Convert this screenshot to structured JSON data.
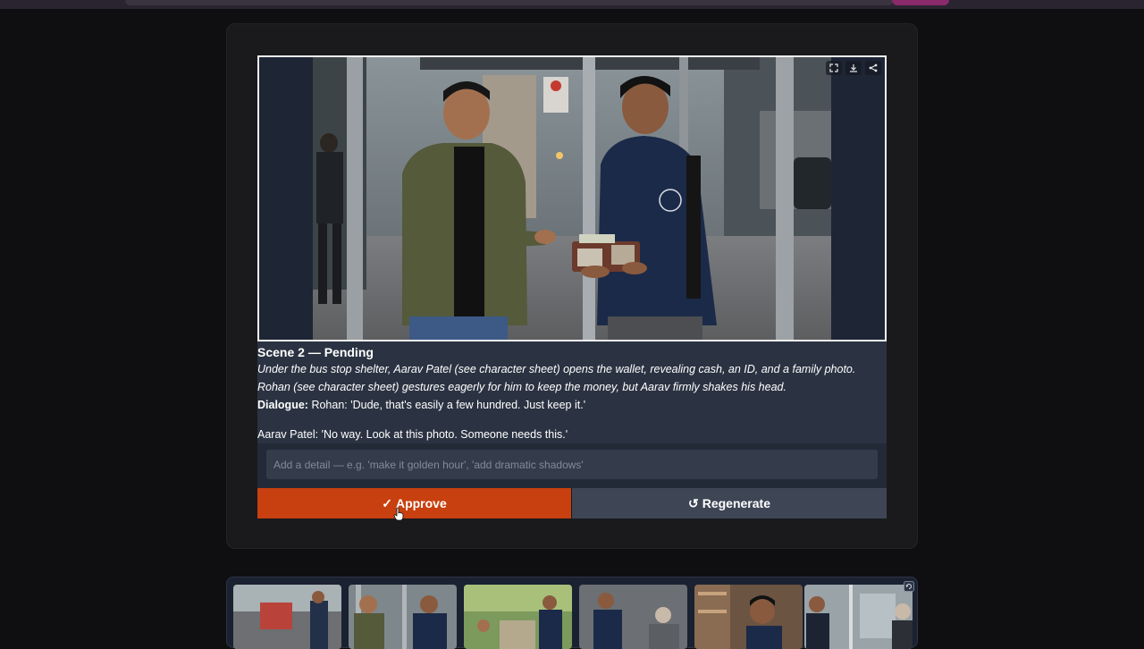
{
  "scene": {
    "title": "Scene 2 — Pending",
    "description_1": "Under the bus stop shelter, Aarav Patel (see character sheet) opens the wallet, revealing cash, an ID, and a family photo.",
    "description_2": "Rohan (see character sheet) gestures eagerly for him to keep the money, but Aarav firmly shakes his head.",
    "dialogue_label": "Dialogue:",
    "dialogue_rohan": "Rohan: 'Dude, that's easily a few hundred. Just keep it.'",
    "dialogue_aarav": "Aarav Patel: 'No way. Look at this photo. Someone needs this.'"
  },
  "image_tools": [
    "fullscreen-icon",
    "download-icon",
    "share-icon"
  ],
  "detail": {
    "placeholder": "Add a detail — e.g. 'make it golden hour', 'add dramatic shadows'",
    "value": ""
  },
  "actions": {
    "approve_glyph": "✓",
    "approve_label": "Approve",
    "regenerate_glyph": "↺",
    "regenerate_label": "Regenerate"
  },
  "colors": {
    "approve": "#c8400f",
    "regenerate": "#3e4655",
    "panel": "#2b3342"
  },
  "filmstrip": {
    "thumbnails": [
      "scene-thumbnail-1",
      "scene-thumbnail-2",
      "scene-thumbnail-3",
      "scene-thumbnail-4",
      "scene-thumbnail-5",
      "scene-thumbnail-6"
    ],
    "icon": "refresh-icon"
  }
}
